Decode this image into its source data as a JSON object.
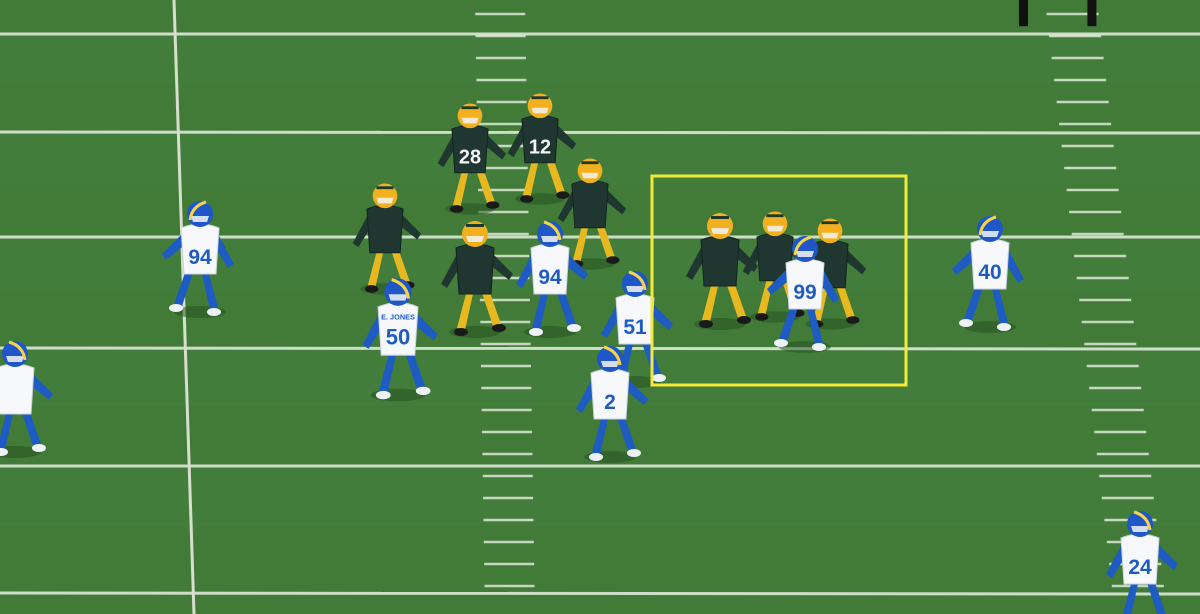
{
  "scene": {
    "subject": "football-field",
    "turf_color": "#417b37",
    "line_color": "#e8efe2",
    "highlight_color": "#f2ea3a"
  },
  "teams": {
    "packers": {
      "jersey": "#203731",
      "pants": "#e8b820",
      "helmet": "#f2b01e",
      "numbers": "#f4f4f4"
    },
    "rams": {
      "jersey": "#f6f8fb",
      "pants": "#1e5cc4",
      "helmet": "#1f56c8",
      "numbers": "#1e5cc4"
    }
  },
  "players": [
    {
      "team": "rams",
      "number": "94"
    },
    {
      "team": "packers",
      "number": "28"
    },
    {
      "team": "packers",
      "number": "12"
    },
    {
      "team": "packers",
      "number": ""
    },
    {
      "team": "packers",
      "number": ""
    },
    {
      "team": "packers",
      "number": ""
    },
    {
      "team": "rams",
      "number": "94"
    },
    {
      "team": "rams",
      "number": "50",
      "nameplate": "E. JONES"
    },
    {
      "team": "rams",
      "number": "51"
    },
    {
      "team": "rams",
      "number": "2"
    },
    {
      "team": "packers",
      "number": ""
    },
    {
      "team": "packers",
      "number": ""
    },
    {
      "team": "packers",
      "number": ""
    },
    {
      "team": "rams",
      "number": "99"
    },
    {
      "team": "rams",
      "number": "40"
    },
    {
      "team": "rams",
      "number": ""
    },
    {
      "team": "rams",
      "number": "24"
    },
    {
      "team": "official",
      "number": ""
    }
  ],
  "highlight": {
    "label": "double-team-block-box"
  }
}
